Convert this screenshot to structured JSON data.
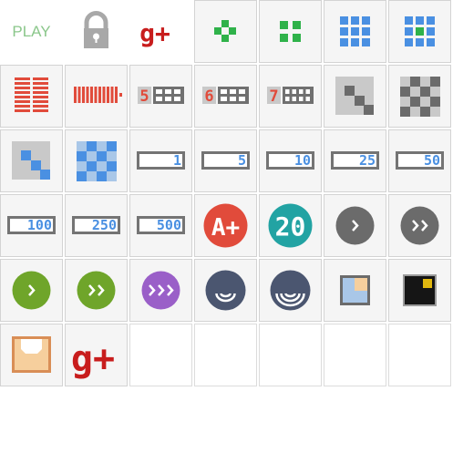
{
  "colors": {
    "green": "#2fb24a",
    "blue": "#4a90e2",
    "red": "#e14b3b",
    "dark_red": "#c81d1d",
    "lock_gray": "#a8a8a8",
    "gray_dark": "#6b6b6b",
    "gray_light": "#c9c9c9",
    "blue_light": "#a9c7e8",
    "teal": "#22a3a3",
    "olive": "#6fa52a",
    "purple": "#9a5fc8",
    "navy": "#4b5670",
    "cream": "#f6cf9d",
    "tan": "#d98e56"
  },
  "tiles": [
    {
      "icon": "play-label",
      "text": "PLAY",
      "bordered": false
    },
    {
      "icon": "lock-icon",
      "bordered": false
    },
    {
      "icon": "google-plus-icon",
      "text": "g+",
      "bordered": false
    },
    {
      "icon": "green-plus-grid-icon",
      "bordered": true
    },
    {
      "icon": "green-four-squares-icon",
      "bordered": true
    },
    {
      "icon": "blue-nine-squares-icon",
      "bordered": true
    },
    {
      "icon": "blue-nine-squares-green-center-icon",
      "bordered": true
    },
    {
      "icon": "red-stacked-bars-icon",
      "bordered": true
    },
    {
      "icon": "red-vertical-bars-icon",
      "bordered": true
    },
    {
      "icon": "five-by-grid-icon",
      "text": "5",
      "bordered": true
    },
    {
      "icon": "six-by-grid-icon",
      "text": "6",
      "bordered": true
    },
    {
      "icon": "seven-by-grid-icon",
      "text": "7",
      "bordered": true
    },
    {
      "icon": "gray-diagonal-checker-icon",
      "bordered": true
    },
    {
      "icon": "gray-checkerboard-icon",
      "bordered": true
    },
    {
      "icon": "blue-diagonal-checker-icon",
      "bordered": true
    },
    {
      "icon": "blue-checkerboard-icon",
      "bordered": true
    },
    {
      "icon": "counter-1-icon",
      "text": "1",
      "bordered": true
    },
    {
      "icon": "counter-5-icon",
      "text": "5",
      "bordered": true
    },
    {
      "icon": "counter-10-icon",
      "text": "10",
      "bordered": true
    },
    {
      "icon": "counter-25-icon",
      "text": "25",
      "bordered": true
    },
    {
      "icon": "counter-50-icon",
      "text": "50",
      "bordered": true
    },
    {
      "icon": "counter-100-icon",
      "text": "100",
      "bordered": true
    },
    {
      "icon": "counter-250-icon",
      "text": "250",
      "bordered": true
    },
    {
      "icon": "counter-500-icon",
      "text": "500",
      "bordered": true
    },
    {
      "icon": "grade-a-plus-badge-icon",
      "text": "A+",
      "bordered": true
    },
    {
      "icon": "level-20-badge-icon",
      "text": "20",
      "bordered": true
    },
    {
      "icon": "gray-single-chevron-icon",
      "bordered": true
    },
    {
      "icon": "gray-double-chevron-icon",
      "bordered": true
    },
    {
      "icon": "green-single-chevron-icon",
      "bordered": true
    },
    {
      "icon": "green-double-chevron-icon",
      "bordered": true
    },
    {
      "icon": "purple-triple-chevron-icon",
      "bordered": true
    },
    {
      "icon": "wifi-small-icon",
      "bordered": true
    },
    {
      "icon": "wifi-large-icon",
      "bordered": true
    },
    {
      "icon": "picture-frame-light-icon",
      "bordered": true
    },
    {
      "icon": "picture-frame-dark-icon",
      "bordered": true
    },
    {
      "icon": "inbox-tray-icon",
      "bordered": true
    },
    {
      "icon": "google-plus-large-icon",
      "text": "g+",
      "bordered": true
    },
    {
      "icon": "empty-slot",
      "bordered": true
    },
    {
      "icon": "empty-slot",
      "bordered": true
    },
    {
      "icon": "empty-slot",
      "bordered": true
    },
    {
      "icon": "empty-slot",
      "bordered": true
    },
    {
      "icon": "empty-slot",
      "bordered": true
    }
  ]
}
